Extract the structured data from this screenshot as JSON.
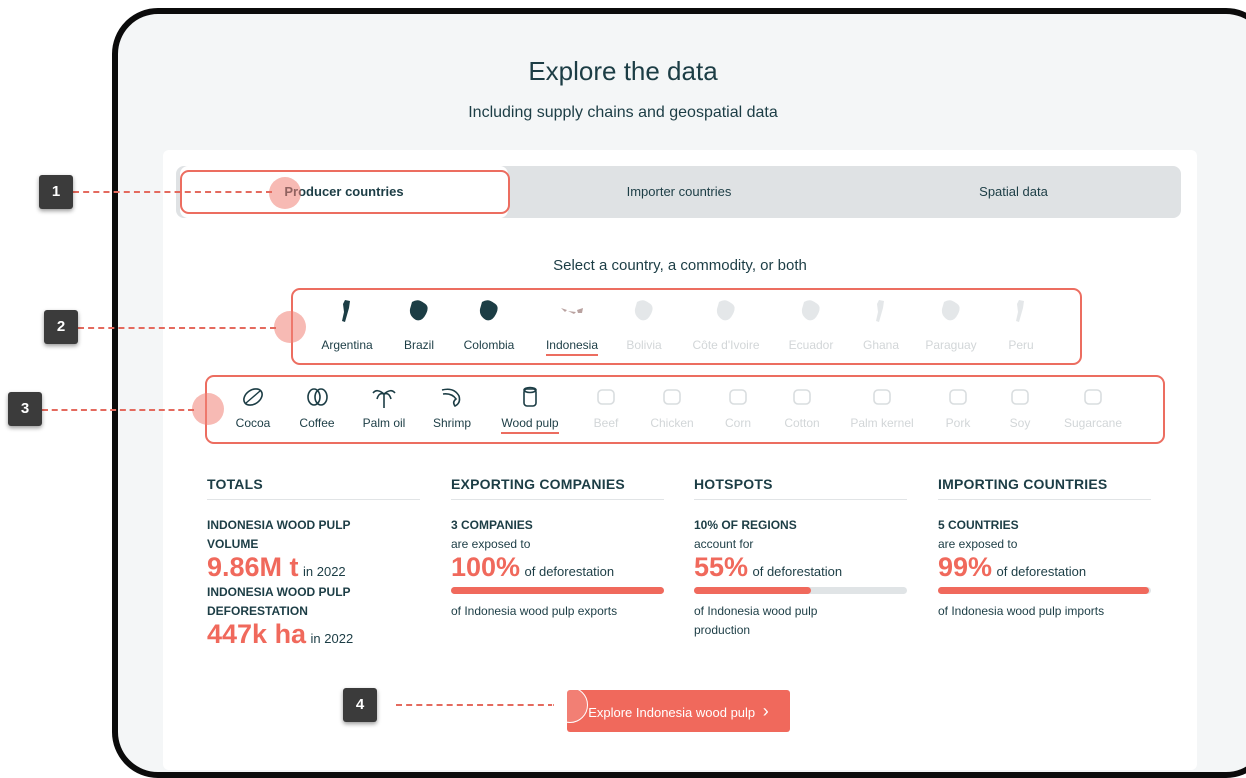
{
  "header": {
    "title": "Explore the data",
    "subtitle": "Including supply chains and geospatial data"
  },
  "tabs": [
    {
      "label": "Producer countries",
      "active": true
    },
    {
      "label": "Importer countries",
      "active": false
    },
    {
      "label": "Spatial data",
      "active": false
    }
  ],
  "select_label": "Select a country, a commodity, or both",
  "countries": [
    {
      "label": "Argentina",
      "enabled": true,
      "selected": false,
      "icon": "argentina-map-icon"
    },
    {
      "label": "Brazil",
      "enabled": true,
      "selected": false,
      "icon": "brazil-map-icon"
    },
    {
      "label": "Colombia",
      "enabled": true,
      "selected": false,
      "icon": "colombia-map-icon"
    },
    {
      "label": "Indonesia",
      "enabled": true,
      "selected": true,
      "icon": "indonesia-map-icon"
    },
    {
      "label": "Bolivia",
      "enabled": false,
      "selected": false,
      "icon": "bolivia-map-icon"
    },
    {
      "label": "Côte d'Ivoire",
      "enabled": false,
      "selected": false,
      "icon": "cote-divoire-map-icon"
    },
    {
      "label": "Ecuador",
      "enabled": false,
      "selected": false,
      "icon": "ecuador-map-icon"
    },
    {
      "label": "Ghana",
      "enabled": false,
      "selected": false,
      "icon": "ghana-map-icon"
    },
    {
      "label": "Paraguay",
      "enabled": false,
      "selected": false,
      "icon": "paraguay-map-icon"
    },
    {
      "label": "Peru",
      "enabled": false,
      "selected": false,
      "icon": "peru-map-icon"
    }
  ],
  "commodities": [
    {
      "label": "Cocoa",
      "enabled": true,
      "selected": false,
      "icon": "cocoa-icon"
    },
    {
      "label": "Coffee",
      "enabled": true,
      "selected": false,
      "icon": "coffee-icon"
    },
    {
      "label": "Palm oil",
      "enabled": true,
      "selected": false,
      "icon": "palm-oil-icon"
    },
    {
      "label": "Shrimp",
      "enabled": true,
      "selected": false,
      "icon": "shrimp-icon"
    },
    {
      "label": "Wood pulp",
      "enabled": true,
      "selected": true,
      "icon": "wood-pulp-icon"
    },
    {
      "label": "Beef",
      "enabled": false,
      "selected": false,
      "icon": "beef-icon"
    },
    {
      "label": "Chicken",
      "enabled": false,
      "selected": false,
      "icon": "chicken-icon"
    },
    {
      "label": "Corn",
      "enabled": false,
      "selected": false,
      "icon": "corn-icon"
    },
    {
      "label": "Cotton",
      "enabled": false,
      "selected": false,
      "icon": "cotton-icon"
    },
    {
      "label": "Palm kernel",
      "enabled": false,
      "selected": false,
      "icon": "palm-kernel-icon"
    },
    {
      "label": "Pork",
      "enabled": false,
      "selected": false,
      "icon": "pork-icon"
    },
    {
      "label": "Soy",
      "enabled": false,
      "selected": false,
      "icon": "soy-icon"
    },
    {
      "label": "Sugarcane",
      "enabled": false,
      "selected": false,
      "icon": "sugarcane-icon"
    }
  ],
  "totals": {
    "heading": "TOTALS",
    "volume_label": "INDONESIA WOOD PULP VOLUME",
    "volume_value": "9.86M t",
    "volume_year": "in 2022",
    "deforestation_label": "INDONESIA WOOD PULP DEFORESTATION",
    "deforestation_value": "447k ha",
    "deforestation_year": "in 2022"
  },
  "exporting": {
    "heading": "EXPORTING COMPANIES",
    "count": "3 COMPANIES",
    "line2": "are exposed to",
    "percent": "100%",
    "percent_suffix": "of deforestation",
    "bar_fraction": 1.0,
    "footer": "of Indonesia wood pulp exports"
  },
  "hotspots": {
    "heading": "HOTSPOTS",
    "count": "10% OF REGIONS",
    "line2": "account for",
    "percent": "55%",
    "percent_suffix": "of deforestation",
    "bar_fraction": 0.55,
    "footer": "of Indonesia wood pulp production"
  },
  "importing": {
    "heading": "IMPORTING COUNTRIES",
    "count": "5 COUNTRIES",
    "line2": "are exposed to",
    "percent": "99%",
    "percent_suffix": "of deforestation",
    "bar_fraction": 0.99,
    "footer": "of Indonesia wood pulp imports"
  },
  "cta": {
    "label": "Explore Indonesia wood pulp",
    "chevron": "›"
  },
  "annotations": [
    "1",
    "2",
    "3",
    "4"
  ],
  "colors": {
    "accent": "#f0695c",
    "text": "#1c3d45",
    "tab_bg": "#dfe2e4",
    "disabled": "#d2d6d8"
  }
}
